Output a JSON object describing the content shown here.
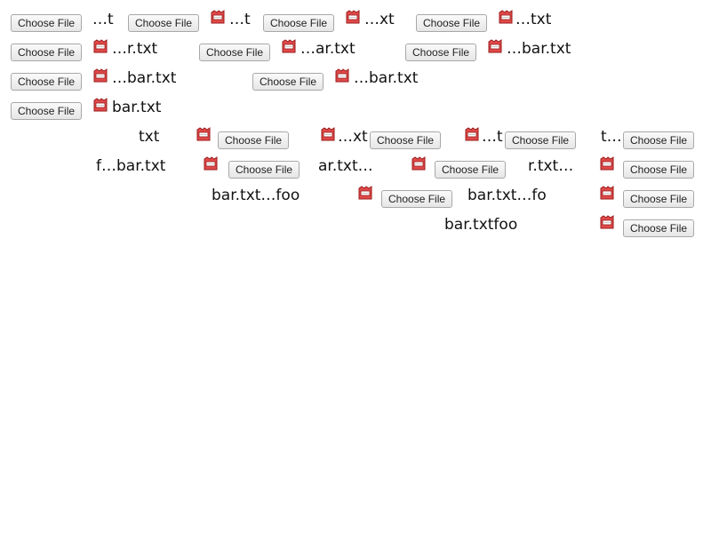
{
  "choose_label": "Choose File",
  "icon": "file-icon-red",
  "colors": {
    "icon_fill": "#e04a4a",
    "icon_border": "#9b1b1b",
    "button_border": "#a8a8a8"
  },
  "inputs": [
    {
      "name": "…t"
    },
    {
      "name": "…t"
    },
    {
      "name": "…xt"
    },
    {
      "name": "…txt"
    },
    {
      "name": "…r.txt"
    },
    {
      "name": "…ar.txt"
    },
    {
      "name": "…bar.txt"
    },
    {
      "name": "…bar.txt"
    },
    {
      "name": "…bar.txt"
    },
    {
      "name": "bar.txt"
    },
    {
      "name": "txt"
    },
    {
      "name": "…xt"
    },
    {
      "name": "…t"
    },
    {
      "name": "t…"
    },
    {
      "name": "f…bar.txt"
    },
    {
      "name": "ar.txt…"
    },
    {
      "name": "r.txt…"
    },
    {
      "name": "bar.txt…foo"
    },
    {
      "name": "bar.txt…fo"
    },
    {
      "name": "bar.txtfoo"
    }
  ]
}
